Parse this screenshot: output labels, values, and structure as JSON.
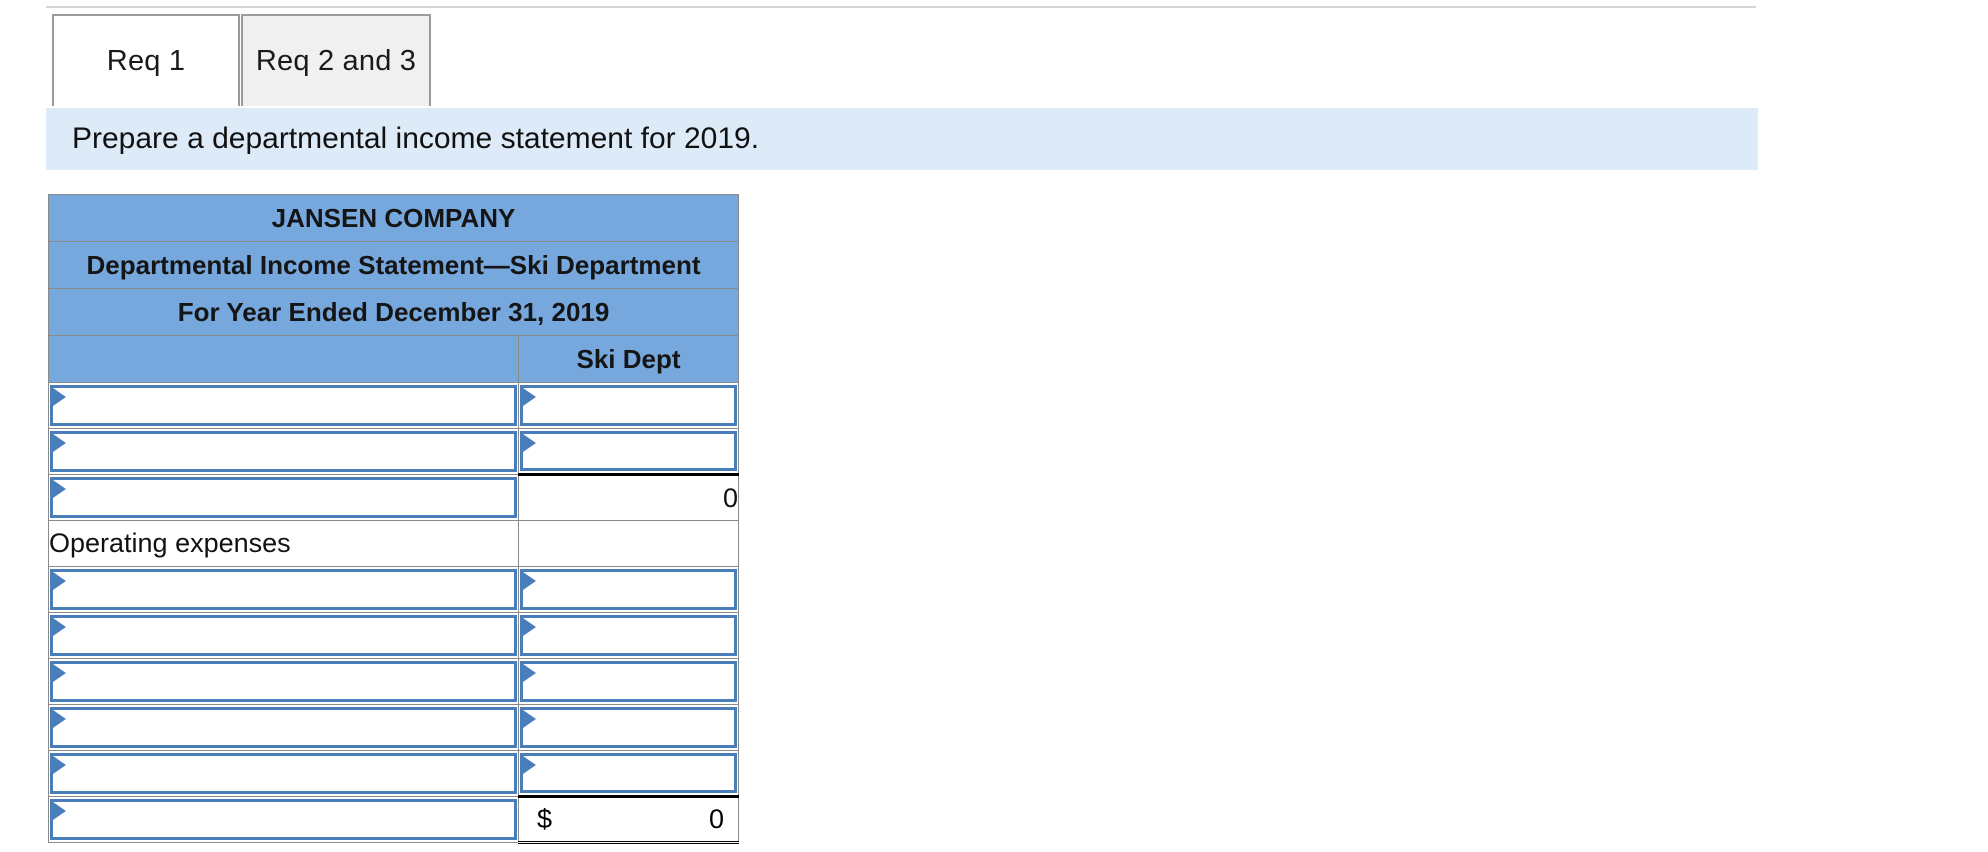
{
  "top_rule": true,
  "tabs": [
    {
      "label": "Req 1",
      "active": true
    },
    {
      "label": "Req 2 and 3",
      "active": false
    }
  ],
  "banner": {
    "text": "Prepare a departmental income statement for 2019."
  },
  "statement": {
    "title_lines": [
      "JANSEN COMPANY",
      "Departmental Income Statement—Ski Department",
      "For Year Ended December 31, 2019"
    ],
    "column_headers": [
      "",
      "Ski Dept"
    ],
    "rows": [
      {
        "label": "",
        "label_type": "dropdown",
        "value": "",
        "value_type": "dropdown"
      },
      {
        "label": "",
        "label_type": "dropdown",
        "value": "",
        "value_type": "dropdown"
      },
      {
        "label": "",
        "label_type": "dropdown",
        "value": "0",
        "value_type": "subtotal"
      },
      {
        "label": "Operating expenses",
        "label_type": "text",
        "value": "",
        "value_type": "blank"
      },
      {
        "label": "",
        "label_type": "dropdown",
        "value": "",
        "value_type": "dropdown"
      },
      {
        "label": "",
        "label_type": "dropdown",
        "value": "",
        "value_type": "dropdown"
      },
      {
        "label": "",
        "label_type": "dropdown",
        "value": "",
        "value_type": "dropdown"
      },
      {
        "label": "",
        "label_type": "dropdown",
        "value": "",
        "value_type": "dropdown"
      },
      {
        "label": "",
        "label_type": "dropdown",
        "value": "",
        "value_type": "dropdown"
      },
      {
        "label": "",
        "label_type": "dropdown",
        "value": "0",
        "value_type": "total",
        "currency": "$"
      }
    ]
  },
  "colors": {
    "header_blue": "#76a7dd",
    "banner_blue": "#dcebf7",
    "input_border": "#4a7ebb",
    "tab_border": "#9b9b9b",
    "tab_inactive": "#f0f0f0"
  }
}
